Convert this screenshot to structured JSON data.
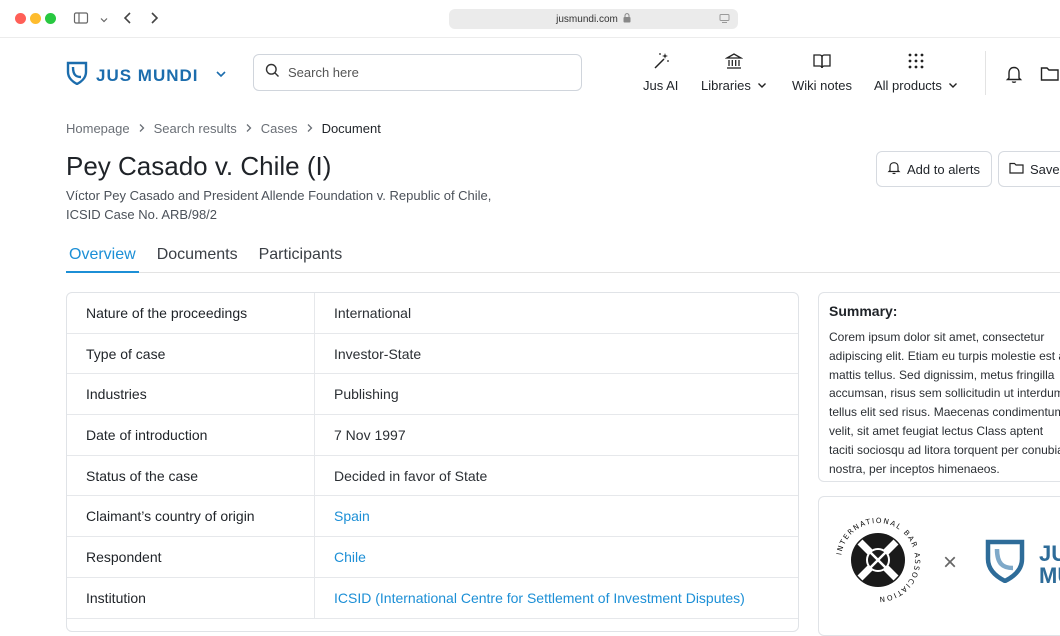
{
  "browser": {
    "url": "jusmundi.com"
  },
  "header": {
    "logo_text": "JUS MUNDI",
    "search_placeholder": "Search here",
    "nav": {
      "jus_ai": "Jus AI",
      "libraries": "Libraries",
      "wiki_notes": "Wiki notes",
      "all_products": "All products"
    }
  },
  "breadcrumb": {
    "home": "Homepage",
    "search_results": "Search results",
    "cases": "Cases",
    "current": "Document"
  },
  "case": {
    "title": "Pey Casado v. Chile (I)",
    "parties": "Víctor Pey Casado and President Allende Foundation v. Republic of Chile,",
    "case_number": "ICSID Case No. ARB/98/2"
  },
  "actions": {
    "add_to_alerts": "Add to alerts",
    "save": "Save"
  },
  "tabs": {
    "overview": "Overview",
    "documents": "Documents",
    "participants": "Participants"
  },
  "details": [
    {
      "label": "Nature of the proceedings",
      "value": "International"
    },
    {
      "label": "Type of case",
      "value": "Investor-State"
    },
    {
      "label": "Industries",
      "value": "Publishing"
    },
    {
      "label": "Date of introduction",
      "value": "7 Nov 1997"
    },
    {
      "label": "Status of the case",
      "value": "Decided in favor of State"
    },
    {
      "label": "Claimant’s country of origin",
      "value": "Spain"
    },
    {
      "label": "Respondent",
      "value": "Chile"
    },
    {
      "label": "Institution",
      "value": "ICSID (International Centre for Settlement of Investment Disputes)"
    }
  ],
  "summary": {
    "title": "Summary:",
    "text": "Corem ipsum dolor sit amet, consectetur adipiscing elit. Etiam eu turpis molestie est a, mattis tellus. Sed dignissim, metus fringilla accumsan, risus sem sollicitudin ut interdum tellus elit sed risus. Maecenas condimentum velit, sit amet feugiat lectus Class aptent taciti sociosqu ad litora torquent per conubia nostra, per inceptos himenaeos."
  },
  "partner": {
    "iba_text": "INTERNATIONAL BAR ASSOCIATION",
    "times": "×",
    "jm_partial": "JU\nMU"
  },
  "colors": {
    "brand": "#1c6dad",
    "link": "#1c8fd6"
  }
}
